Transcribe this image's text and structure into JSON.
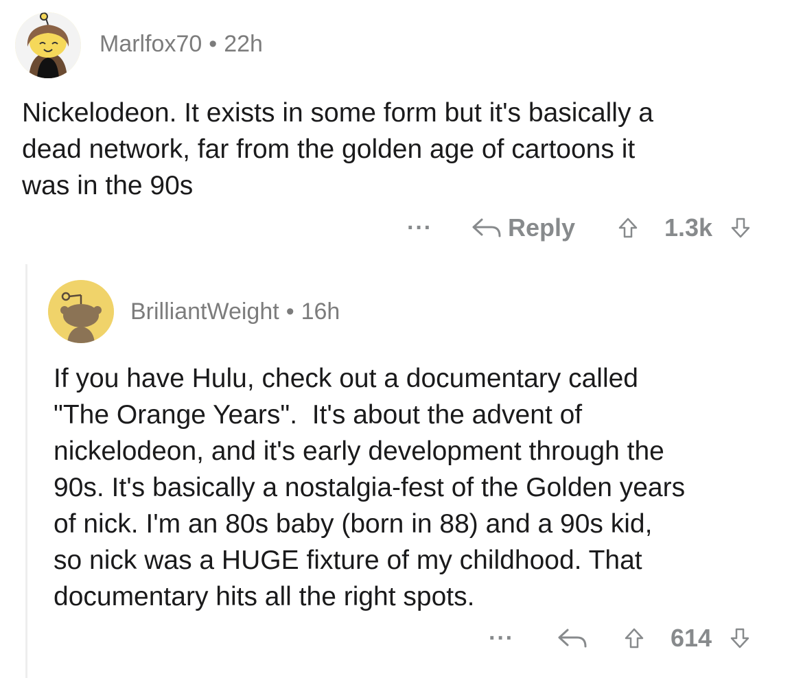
{
  "comments": [
    {
      "username": "Marlfox70",
      "separator": "•",
      "time": "22h",
      "text": "Nickelodeon. It exists in some form but it's basically a\ndead network, far from the golden age of cartoons it\nwas in the 90s",
      "more_label": "···",
      "reply_label": "Reply",
      "score": "1.3k",
      "avatar_color": "#fff4a3"
    },
    {
      "username": "BrilliantWeight",
      "separator": "•",
      "time": "16h",
      "text": "If you have Hulu, check out a documentary called\n\"The Orange Years\".  It's about the advent of\nnickelodeon, and it's early development through the\n90s. It's basically a nostalgia-fest of the Golden years\nof nick. I'm an 80s baby (born in 88) and a 90s kid,\nso nick was a HUGE fixture of my childhood. That\ndocumentary hits all the right spots.",
      "more_label": "···",
      "score": "614",
      "avatar_color": "#f0d36a"
    }
  ],
  "colors": {
    "text": "#1a1a1b",
    "meta": "#7c7c7c",
    "action": "#878a8c"
  },
  "icons": [
    "snoo-avatar-icon",
    "reply-arrow-icon",
    "upvote-icon",
    "downvote-icon"
  ]
}
